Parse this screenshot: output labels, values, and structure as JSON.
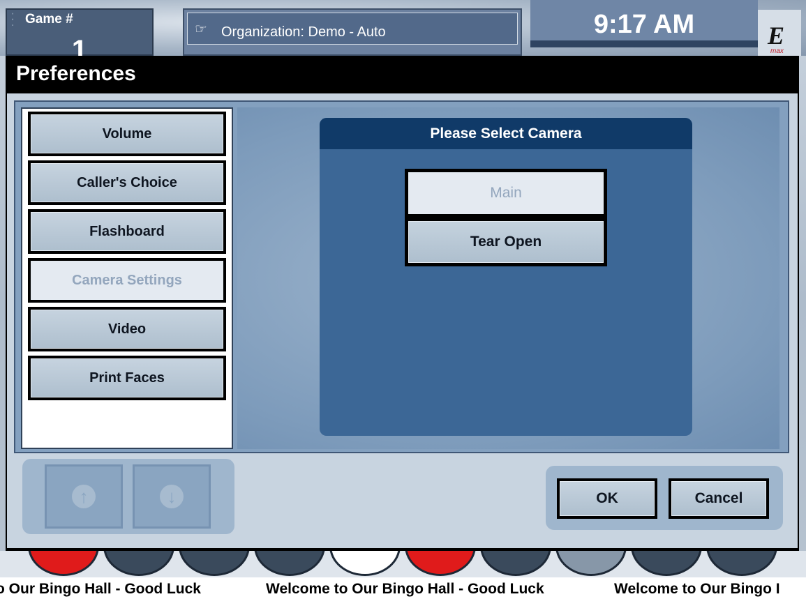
{
  "header": {
    "game_label": "Game #",
    "game_number": "1",
    "organization": "Organization: Demo - Auto",
    "time": "9:17 AM",
    "logo_text": "E",
    "logo_subtext": "max"
  },
  "dialog": {
    "title": "Preferences",
    "nav_items": [
      {
        "label": "Volume",
        "selected": false
      },
      {
        "label": "Caller's Choice",
        "selected": false
      },
      {
        "label": "Flashboard",
        "selected": false
      },
      {
        "label": "Camera Settings",
        "selected": true
      },
      {
        "label": "Video",
        "selected": false
      },
      {
        "label": "Print Faces",
        "selected": false
      }
    ],
    "camera_panel": {
      "title": "Please Select Camera",
      "options": [
        {
          "label": "Main",
          "selected": true
        },
        {
          "label": "Tear Open",
          "selected": false
        }
      ]
    },
    "ok_label": "OK",
    "cancel_label": "Cancel",
    "scroll_up_icon": "arrow-up-circle",
    "scroll_down_icon": "arrow-down-circle"
  },
  "ball_colors": [
    "#e01b1b",
    "#3a4a5c",
    "#3a4a5c",
    "#3a4a5c",
    "#ffffff",
    "#e01b1b",
    "#3a4a5c",
    "#8797a8",
    "#3a4a5c",
    "#3a4a5c"
  ],
  "ticker": {
    "segments": [
      "o Our Bingo Hall - Good Luck",
      "Welcome to Our Bingo Hall - Good Luck",
      "Welcome to Our Bingo I"
    ]
  }
}
